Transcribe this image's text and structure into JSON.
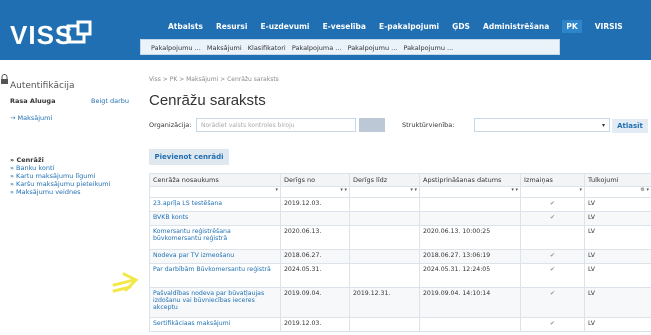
{
  "header": {
    "logo_text": "VISS",
    "nav": [
      "Atbalsts",
      "Resursi",
      "E-uzdevumi",
      "E-veselība",
      "E-pakalpojumi",
      "ĢDS",
      "Administrēšana",
      "PK",
      "VIRSIS"
    ],
    "active_nav": "PK",
    "subnav": [
      "Pakalpojumu ...",
      "Maksājumi",
      "Klasifikatori",
      "Pakalpojuma ...",
      "Pakalpojumu ...",
      "Pakalpojumu ..."
    ]
  },
  "sidebar": {
    "title": "Autentifikācija",
    "user": "Rasa Aluuga",
    "logout": "Beigt darbu",
    "link": "→ Maksājumi",
    "menu": [
      "» Cenrāži",
      "» Banku konti",
      "» Kartu maksājumu līgumi",
      "» Karšu maksājumu pieteikumi",
      "» Maksājumu veidnes"
    ],
    "active": "» Cenrāži"
  },
  "main": {
    "breadcrumb": "Viss > PK > Maksājumi > Cenrāžu saraksts",
    "title": "Cenrāžu saraksts",
    "org_label": "Organizācija:",
    "org_placeholder": "Norādiet valsts kontroles biroju",
    "struct_label": "Struktūrvienība:",
    "search_button": "Atlasīt",
    "add_button": "Pievienot cenrādi"
  },
  "table": {
    "columns": [
      "Cenrāža nosaukums",
      "Derīgs no",
      "Derīgs līdz",
      "Apstiprināšanas datums",
      "Izmaiņas",
      "Tulkojumi"
    ],
    "rows": [
      {
        "name": "23.aprīļa LS testēšana",
        "from": "2019.12.03.",
        "to": "",
        "approved": "",
        "changed": "✔",
        "lang": "LV",
        "h": "h1"
      },
      {
        "name": "BVKB konts",
        "from": "",
        "to": "",
        "approved": "",
        "changed": "✔",
        "lang": "LV",
        "h": "h1"
      },
      {
        "name": "Komersantu reģistrēšana būvkomersantu reģistrā",
        "from": "2020.06.13.",
        "to": "",
        "approved": "2020.06.13. 10:00:25",
        "changed": "",
        "lang": "LV",
        "h": "h2"
      },
      {
        "name": "Nodeva par TV izmeošanu",
        "from": "2018.06.27.",
        "to": "",
        "approved": "2018.06.27. 13:06:19",
        "changed": "✔",
        "lang": "LV",
        "h": "h1"
      },
      {
        "name": "Par darbībām Būvkomersantu reģistrā",
        "from": "2024.05.31.",
        "to": "",
        "approved": "2024.05.31. 12:24:05",
        "changed": "✔",
        "lang": "LV",
        "h": "h2"
      },
      {
        "name": "Pašvaldības nodeva par būvatļaujas izdošanu vai būvniecības ieceres akceptu",
        "from": "2019.09.04.",
        "to": "2019.12.31.",
        "approved": "2019.09.04. 14:10:14",
        "changed": "✔",
        "lang": "LV",
        "h": "h3"
      },
      {
        "name": "Sertifikāciaas maksājumi",
        "from": "2019.12.03.",
        "to": "",
        "approved": "",
        "changed": "✔",
        "lang": "LV",
        "h": "h1"
      }
    ]
  },
  "colors": {
    "topbar": "#1f6fb2",
    "link": "#1f6fb2",
    "arrow": "#f3e84a"
  }
}
